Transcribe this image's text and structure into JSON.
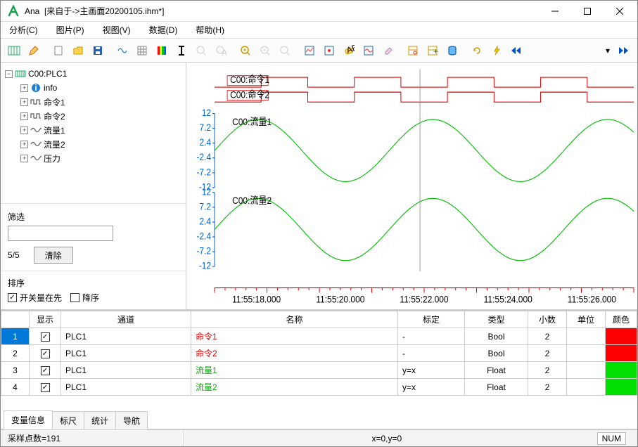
{
  "window": {
    "app_name": "Ana",
    "title_suffix": "[来自于->主画面20200105.ihm*]"
  },
  "menu": {
    "analysis": "分析(C)",
    "image": "图片(P)",
    "view": "视图(V)",
    "data": "数据(D)",
    "help": "帮助(H)"
  },
  "tree": {
    "root": "C00:PLC1",
    "items": [
      {
        "label": "info",
        "icon": "info"
      },
      {
        "label": "命令1",
        "icon": "digital"
      },
      {
        "label": "命令2",
        "icon": "digital"
      },
      {
        "label": "流量1",
        "icon": "analog"
      },
      {
        "label": "流量2",
        "icon": "analog"
      },
      {
        "label": "压力",
        "icon": "analog"
      }
    ]
  },
  "filter": {
    "label": "筛选",
    "value": "",
    "count": "5/5",
    "clear_label": "清除"
  },
  "sort": {
    "label": "排序",
    "switch_first": "开关量在先",
    "switch_first_checked": true,
    "descending": "降序",
    "descending_checked": false
  },
  "chart_data": {
    "type": "timeseries",
    "x_ticks": [
      "11:55:18.000",
      "11:55:20.000",
      "11:55:22.000",
      "11:55:24.000",
      "11:55:26.000"
    ],
    "digital": [
      {
        "name": "C00:命令1",
        "states": [
          0,
          1,
          0,
          1,
          0,
          1,
          0,
          1,
          0
        ],
        "color": "#d00"
      },
      {
        "name": "C00:命令2",
        "states": [
          0,
          1,
          0,
          1,
          0,
          1,
          0,
          1,
          0
        ],
        "color": "#d00"
      }
    ],
    "analog": [
      {
        "name": "C00:流量1",
        "ylim": [
          -12,
          12
        ],
        "yticks": [
          -12,
          -7.2,
          -2.4,
          2.4,
          7.2,
          12
        ],
        "wave": "sine",
        "amplitude": 10,
        "color": "#0b0"
      },
      {
        "name": "C00:流量2",
        "ylim": [
          -12,
          12
        ],
        "yticks": [
          -12,
          -7.2,
          -2.4,
          2.4,
          7.2,
          12
        ],
        "wave": "sine",
        "amplitude": 10,
        "color": "#0b0"
      }
    ],
    "cursor_x_frac": 0.49
  },
  "table": {
    "headers": {
      "show": "显示",
      "channel": "通道",
      "name": "名称",
      "cal": "标定",
      "type": "类型",
      "dec": "小数",
      "unit": "单位",
      "color": "颜色"
    },
    "rows": [
      {
        "n": "1",
        "show": true,
        "channel": "PLC1",
        "name": "命令1",
        "name_color": "red",
        "cal": "-",
        "type": "Bool",
        "dec": "2",
        "unit": "",
        "color": "#ff0000",
        "active": true
      },
      {
        "n": "2",
        "show": true,
        "channel": "PLC1",
        "name": "命令2",
        "name_color": "red",
        "cal": "-",
        "type": "Bool",
        "dec": "2",
        "unit": "",
        "color": "#ff0000"
      },
      {
        "n": "3",
        "show": true,
        "channel": "PLC1",
        "name": "流量1",
        "name_color": "green",
        "cal": "y=x",
        "type": "Float",
        "dec": "2",
        "unit": "",
        "color": "#00e000"
      },
      {
        "n": "4",
        "show": true,
        "channel": "PLC1",
        "name": "流量2",
        "name_color": "green",
        "cal": "y=x",
        "type": "Float",
        "dec": "2",
        "unit": "",
        "color": "#00e000"
      }
    ]
  },
  "bottom_tabs": {
    "var_info": "变量信息",
    "ruler": "标尺",
    "stats": "统计",
    "nav": "导航",
    "active": "var_info"
  },
  "status": {
    "samples": "采样点数=191",
    "coords": "x=0,y=0",
    "num": "NUM"
  }
}
